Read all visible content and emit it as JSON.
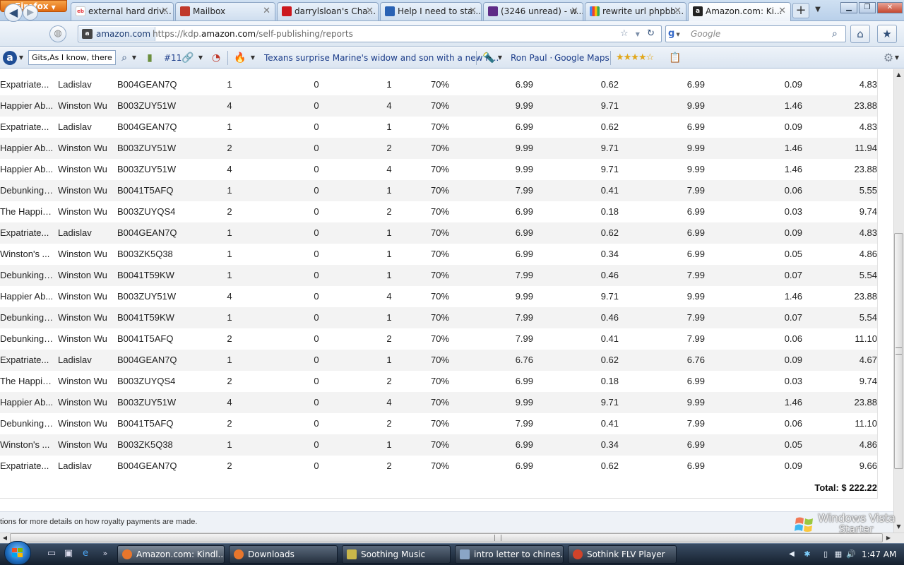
{
  "browser": {
    "menu_label": "Firefox",
    "tabs": [
      {
        "label": "external hard driv...",
        "icon_color": "#e53238"
      },
      {
        "label": "Mailbox",
        "icon_color": "#c0392b"
      },
      {
        "label": "darrylsloan's Cha...",
        "icon_color": "#cc181e"
      },
      {
        "label": "Help I need to sta...",
        "icon_color": "#2a62b4"
      },
      {
        "label": "(3246 unread) - w...",
        "icon_color": "#5f2b87"
      },
      {
        "label": "rewrite url phpbb...",
        "icon_color": "#4285f4"
      },
      {
        "label": "Amazon.com: Ki...",
        "icon_color": "#222222"
      }
    ],
    "new_tab_label": "+",
    "identity_label": "amazon.com",
    "url_prefix": "https://kdp.",
    "url_host": "amazon.com",
    "url_path": "/self-publishing/reports",
    "search_placeholder": "Google"
  },
  "toolbar": {
    "search_value": "Gits,As I know, there a",
    "hash_label": "#11",
    "headline_link": "Texans surprise Marine's widow and son with a new h...",
    "bookmark_1": "Ron Paul",
    "bookmark_2": "Google Maps"
  },
  "report": {
    "rows": [
      {
        "title": "Expatriate...",
        "author": "Ladislav",
        "asin": "B004GEAN7Q",
        "units": "1",
        "refunded": "0",
        "net": "1",
        "royalty_type": "70%",
        "list_price": "6.99",
        "delivery_fee": "0.62",
        "offer_price": "6.99",
        "vat": "0.09",
        "royalty": "4.83"
      },
      {
        "title": "Happier Ab...",
        "author": "Winston Wu",
        "asin": "B003ZUY51W",
        "units": "4",
        "refunded": "0",
        "net": "4",
        "royalty_type": "70%",
        "list_price": "9.99",
        "delivery_fee": "9.71",
        "offer_price": "9.99",
        "vat": "1.46",
        "royalty": "23.88"
      },
      {
        "title": "Expatriate...",
        "author": "Ladislav",
        "asin": "B004GEAN7Q",
        "units": "1",
        "refunded": "0",
        "net": "1",
        "royalty_type": "70%",
        "list_price": "6.99",
        "delivery_fee": "0.62",
        "offer_price": "6.99",
        "vat": "0.09",
        "royalty": "4.83"
      },
      {
        "title": "Happier Ab...",
        "author": "Winston Wu",
        "asin": "B003ZUY51W",
        "units": "2",
        "refunded": "0",
        "net": "2",
        "royalty_type": "70%",
        "list_price": "9.99",
        "delivery_fee": "9.71",
        "offer_price": "9.99",
        "vat": "1.46",
        "royalty": "11.94"
      },
      {
        "title": "Happier Ab...",
        "author": "Winston Wu",
        "asin": "B003ZUY51W",
        "units": "4",
        "refunded": "0",
        "net": "4",
        "royalty_type": "70%",
        "list_price": "9.99",
        "delivery_fee": "9.71",
        "offer_price": "9.99",
        "vat": "1.46",
        "royalty": "23.88"
      },
      {
        "title": "Debunking ...",
        "author": "Winston Wu",
        "asin": "B0041T5AFQ",
        "units": "1",
        "refunded": "0",
        "net": "1",
        "royalty_type": "70%",
        "list_price": "7.99",
        "delivery_fee": "0.41",
        "offer_price": "7.99",
        "vat": "0.06",
        "royalty": "5.55"
      },
      {
        "title": "The Happie...",
        "author": "Winston Wu",
        "asin": "B003ZUYQS4",
        "units": "2",
        "refunded": "0",
        "net": "2",
        "royalty_type": "70%",
        "list_price": "6.99",
        "delivery_fee": "0.18",
        "offer_price": "6.99",
        "vat": "0.03",
        "royalty": "9.74"
      },
      {
        "title": "Expatriate...",
        "author": "Ladislav",
        "asin": "B004GEAN7Q",
        "units": "1",
        "refunded": "0",
        "net": "1",
        "royalty_type": "70%",
        "list_price": "6.99",
        "delivery_fee": "0.62",
        "offer_price": "6.99",
        "vat": "0.09",
        "royalty": "4.83"
      },
      {
        "title": "Winston's ...",
        "author": "Winston Wu",
        "asin": "B003ZK5Q38",
        "units": "1",
        "refunded": "0",
        "net": "1",
        "royalty_type": "70%",
        "list_price": "6.99",
        "delivery_fee": "0.34",
        "offer_price": "6.99",
        "vat": "0.05",
        "royalty": "4.86"
      },
      {
        "title": "Debunking ...",
        "author": "Winston Wu",
        "asin": "B0041T59KW",
        "units": "1",
        "refunded": "0",
        "net": "1",
        "royalty_type": "70%",
        "list_price": "7.99",
        "delivery_fee": "0.46",
        "offer_price": "7.99",
        "vat": "0.07",
        "royalty": "5.54"
      },
      {
        "title": "Happier Ab...",
        "author": "Winston Wu",
        "asin": "B003ZUY51W",
        "units": "4",
        "refunded": "0",
        "net": "4",
        "royalty_type": "70%",
        "list_price": "9.99",
        "delivery_fee": "9.71",
        "offer_price": "9.99",
        "vat": "1.46",
        "royalty": "23.88"
      },
      {
        "title": "Debunking ...",
        "author": "Winston Wu",
        "asin": "B0041T59KW",
        "units": "1",
        "refunded": "0",
        "net": "1",
        "royalty_type": "70%",
        "list_price": "7.99",
        "delivery_fee": "0.46",
        "offer_price": "7.99",
        "vat": "0.07",
        "royalty": "5.54"
      },
      {
        "title": "Debunking ...",
        "author": "Winston Wu",
        "asin": "B0041T5AFQ",
        "units": "2",
        "refunded": "0",
        "net": "2",
        "royalty_type": "70%",
        "list_price": "7.99",
        "delivery_fee": "0.41",
        "offer_price": "7.99",
        "vat": "0.06",
        "royalty": "11.10"
      },
      {
        "title": "Expatriate...",
        "author": "Ladislav",
        "asin": "B004GEAN7Q",
        "units": "1",
        "refunded": "0",
        "net": "1",
        "royalty_type": "70%",
        "list_price": "6.76",
        "delivery_fee": "0.62",
        "offer_price": "6.76",
        "vat": "0.09",
        "royalty": "4.67"
      },
      {
        "title": "The Happie...",
        "author": "Winston Wu",
        "asin": "B003ZUYQS4",
        "units": "2",
        "refunded": "0",
        "net": "2",
        "royalty_type": "70%",
        "list_price": "6.99",
        "delivery_fee": "0.18",
        "offer_price": "6.99",
        "vat": "0.03",
        "royalty": "9.74"
      },
      {
        "title": "Happier Ab...",
        "author": "Winston Wu",
        "asin": "B003ZUY51W",
        "units": "4",
        "refunded": "0",
        "net": "4",
        "royalty_type": "70%",
        "list_price": "9.99",
        "delivery_fee": "9.71",
        "offer_price": "9.99",
        "vat": "1.46",
        "royalty": "23.88"
      },
      {
        "title": "Debunking ...",
        "author": "Winston Wu",
        "asin": "B0041T5AFQ",
        "units": "2",
        "refunded": "0",
        "net": "2",
        "royalty_type": "70%",
        "list_price": "7.99",
        "delivery_fee": "0.41",
        "offer_price": "7.99",
        "vat": "0.06",
        "royalty": "11.10"
      },
      {
        "title": "Winston's ...",
        "author": "Winston Wu",
        "asin": "B003ZK5Q38",
        "units": "1",
        "refunded": "0",
        "net": "1",
        "royalty_type": "70%",
        "list_price": "6.99",
        "delivery_fee": "0.34",
        "offer_price": "6.99",
        "vat": "0.05",
        "royalty": "4.86"
      },
      {
        "title": "Expatriate...",
        "author": "Ladislav",
        "asin": "B004GEAN7Q",
        "units": "2",
        "refunded": "0",
        "net": "2",
        "royalty_type": "70%",
        "list_price": "6.99",
        "delivery_fee": "0.62",
        "offer_price": "6.99",
        "vat": "0.09",
        "royalty": "9.66"
      }
    ],
    "total_label": "Total: $ 222.22",
    "footnote": "tions for more details on how royalty payments are made."
  },
  "watermark": {
    "line1": "Windows Vista",
    "line2": "Starter"
  },
  "taskbar": {
    "tasks": [
      {
        "label": "Amazon.com: Kindl...",
        "icon_color": "#e8762c"
      },
      {
        "label": "Downloads",
        "icon_color": "#e8762c"
      },
      {
        "label": "Soothing Music",
        "icon_color": "#c9b74a"
      },
      {
        "label": "intro letter to chines...",
        "icon_color": "#8aa5c6"
      },
      {
        "label": "Sothink FLV Player",
        "icon_color": "#d0432a"
      }
    ],
    "clock": "1:47 AM"
  }
}
